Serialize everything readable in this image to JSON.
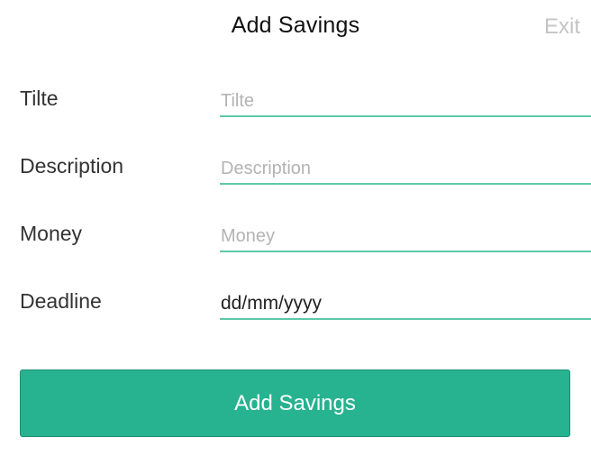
{
  "header": {
    "title": "Add Savings",
    "exit_label": "Exit"
  },
  "form": {
    "fields": [
      {
        "label": "Tilte",
        "placeholder": "Tilte",
        "value": ""
      },
      {
        "label": "Description",
        "placeholder": "Description",
        "value": ""
      },
      {
        "label": "Money",
        "placeholder": "Money",
        "value": ""
      },
      {
        "label": "Deadline",
        "placeholder": "",
        "value": "dd/mm/yyyy"
      }
    ],
    "submit_label": "Add Savings"
  },
  "colors": {
    "accent": "#27b290",
    "underline": "#5fc8a8",
    "exit": "#c4c4c4"
  }
}
